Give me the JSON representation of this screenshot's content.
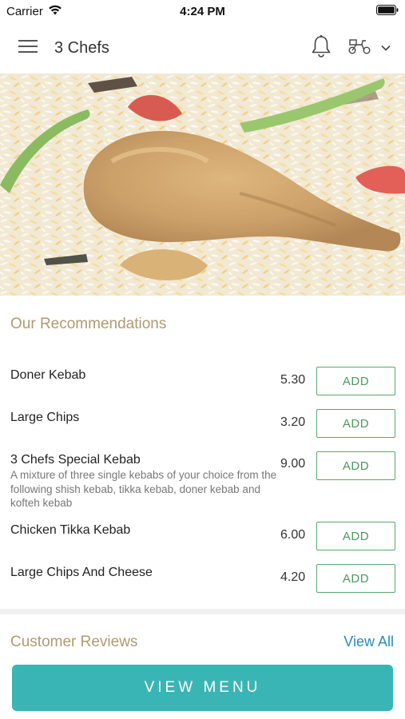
{
  "status_bar": {
    "carrier": "Carrier",
    "time": "4:24 PM"
  },
  "header": {
    "title": "3 Chefs",
    "icons": [
      "menu-icon",
      "bell-icon",
      "scooter-icon",
      "chevron-down-icon"
    ]
  },
  "hero": {
    "image": "chicken-biryani-photo"
  },
  "recommendations": {
    "title": "Our Recommendations",
    "add_label": "ADD",
    "items": [
      {
        "name": "Doner Kebab",
        "description": "",
        "price": "5.30"
      },
      {
        "name": "Large Chips",
        "description": "",
        "price": "3.20"
      },
      {
        "name": "3 Chefs Special Kebab",
        "description": "A mixture of three single kebabs of your choice from the following shish kebab, tikka kebab, doner kebab and kofteh kebab",
        "price": "9.00"
      },
      {
        "name": "Chicken Tikka Kebab",
        "description": "",
        "price": "6.00"
      },
      {
        "name": "Large Chips And Cheese",
        "description": "",
        "price": "4.20"
      }
    ]
  },
  "reviews": {
    "title": "Customer Reviews",
    "view_all_label": "View All"
  },
  "footer": {
    "view_menu_label": "VIEW MENU"
  },
  "colors": {
    "accent_teal": "#3ab5b5",
    "add_green": "#4a9a5e",
    "section_title": "#b09a72",
    "link_blue": "#2a8bb5"
  }
}
